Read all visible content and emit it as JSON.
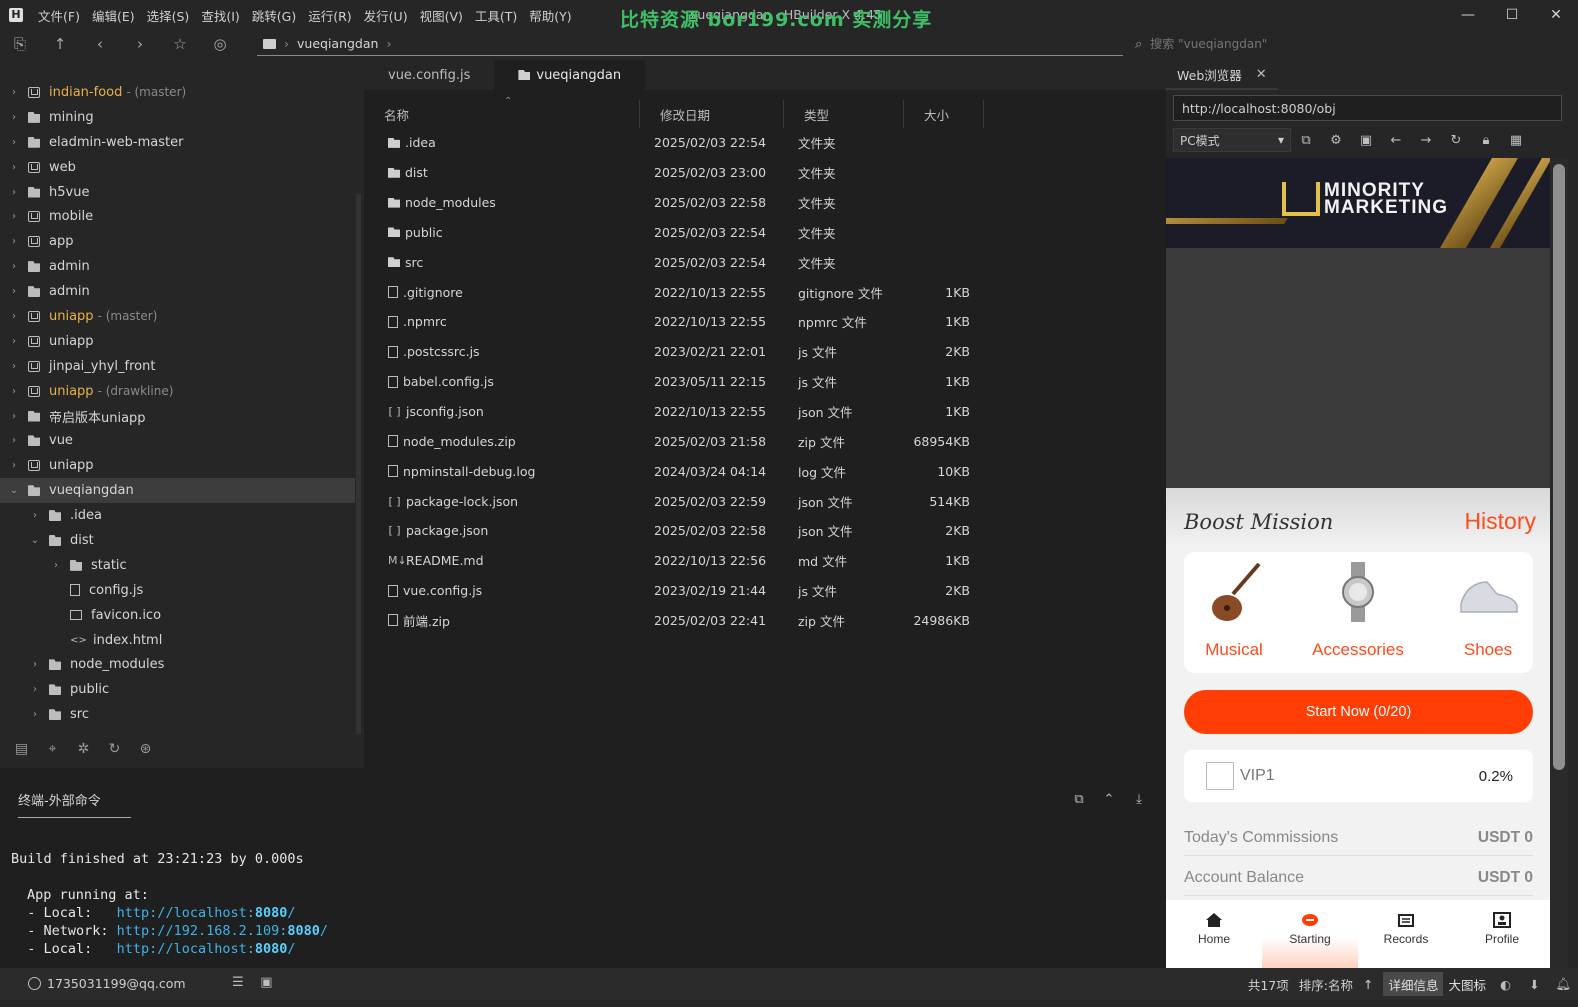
{
  "window": {
    "title": "vueqiangdan - HBuilder X 4.45",
    "watermark": "比特资源 bor199.com 实测分享",
    "menu": [
      "文件(F)",
      "编辑(E)",
      "选择(S)",
      "查找(I)",
      "跳转(G)",
      "运行(R)",
      "发行(U)",
      "视图(V)",
      "工具(T)",
      "帮助(Y)"
    ],
    "min_label": "—",
    "max_label": "☐",
    "close_label": "✕"
  },
  "toolbar": {
    "breadcrumb": "vueqiangdan",
    "search_placeholder": "搜索 \"vueqiangdan\""
  },
  "tree": {
    "items": [
      {
        "name": "indian-food",
        "branch": "- (master)",
        "icon": "u",
        "level": 0,
        "chev": "›",
        "yellow": true
      },
      {
        "name": "mining",
        "icon": "folder",
        "level": 0,
        "chev": "›"
      },
      {
        "name": "eladmin-web-master",
        "icon": "folder",
        "level": 0,
        "chev": "›"
      },
      {
        "name": "web",
        "icon": "u",
        "level": 0,
        "chev": "›"
      },
      {
        "name": "h5vue",
        "icon": "folder",
        "level": 0,
        "chev": "›"
      },
      {
        "name": "mobile",
        "icon": "u",
        "level": 0,
        "chev": "›"
      },
      {
        "name": "app",
        "icon": "u",
        "level": 0,
        "chev": "›"
      },
      {
        "name": "admin",
        "icon": "folder",
        "level": 0,
        "chev": "›"
      },
      {
        "name": "admin",
        "icon": "folder",
        "level": 0,
        "chev": "›"
      },
      {
        "name": "uniapp",
        "branch": "- (master)",
        "icon": "u",
        "level": 0,
        "chev": "›",
        "yellow": true
      },
      {
        "name": "uniapp",
        "icon": "u",
        "level": 0,
        "chev": "›"
      },
      {
        "name": "jinpai_yhyl_front",
        "icon": "u",
        "level": 0,
        "chev": "›"
      },
      {
        "name": "uniapp",
        "branch": "- (drawkline)",
        "icon": "u",
        "level": 0,
        "chev": "›",
        "yellow": true
      },
      {
        "name": "帝启版本uniapp",
        "icon": "folder",
        "level": 0,
        "chev": "›"
      },
      {
        "name": "vue",
        "icon": "folder",
        "level": 0,
        "chev": "›"
      },
      {
        "name": "uniapp",
        "icon": "u",
        "level": 0,
        "chev": "›"
      },
      {
        "name": "vueqiangdan",
        "icon": "folder",
        "level": 0,
        "chev": "⌄",
        "selected": true
      },
      {
        "name": ".idea",
        "icon": "folder",
        "level": 1,
        "chev": "›"
      },
      {
        "name": "dist",
        "icon": "folder",
        "level": 1,
        "chev": "⌄"
      },
      {
        "name": "static",
        "icon": "folder",
        "level": 2,
        "chev": "›"
      },
      {
        "name": "config.js",
        "icon": "file",
        "level": 2,
        "chev": ""
      },
      {
        "name": "favicon.ico",
        "icon": "img",
        "level": 2,
        "chev": ""
      },
      {
        "name": "index.html",
        "icon": "code",
        "level": 2,
        "chev": ""
      },
      {
        "name": "node_modules",
        "icon": "folder",
        "level": 1,
        "chev": "›"
      },
      {
        "name": "public",
        "icon": "folder",
        "level": 1,
        "chev": "›"
      },
      {
        "name": "src",
        "icon": "folder",
        "level": 1,
        "chev": "›"
      }
    ]
  },
  "editor": {
    "tabs": [
      {
        "label": "vue.config.js",
        "active": false
      },
      {
        "label": "vueqiangdan",
        "active": true
      }
    ],
    "columns": {
      "name": "名称",
      "date": "修改日期",
      "type": "类型",
      "size": "大小"
    },
    "files": [
      {
        "name": ".idea",
        "date": "2025/02/03 22:54",
        "type": "文件夹",
        "size": "",
        "icon": "folder"
      },
      {
        "name": "dist",
        "date": "2025/02/03 23:00",
        "type": "文件夹",
        "size": "",
        "icon": "folder"
      },
      {
        "name": "node_modules",
        "date": "2025/02/03 22:58",
        "type": "文件夹",
        "size": "",
        "icon": "folder"
      },
      {
        "name": "public",
        "date": "2025/02/03 22:54",
        "type": "文件夹",
        "size": "",
        "icon": "folder"
      },
      {
        "name": "src",
        "date": "2025/02/03 22:54",
        "type": "文件夹",
        "size": "",
        "icon": "folder"
      },
      {
        "name": ".gitignore",
        "date": "2022/10/13 22:55",
        "type": "gitignore 文件",
        "size": "1KB",
        "icon": "file"
      },
      {
        "name": ".npmrc",
        "date": "2022/10/13 22:55",
        "type": "npmrc 文件",
        "size": "1KB",
        "icon": "file"
      },
      {
        "name": ".postcssrc.js",
        "date": "2023/02/21 22:01",
        "type": "js 文件",
        "size": "2KB",
        "icon": "file"
      },
      {
        "name": "babel.config.js",
        "date": "2023/05/11 22:15",
        "type": "js 文件",
        "size": "1KB",
        "icon": "file"
      },
      {
        "name": "jsconfig.json",
        "date": "2022/10/13 22:55",
        "type": "json 文件",
        "size": "1KB",
        "icon": "json"
      },
      {
        "name": "node_modules.zip",
        "date": "2025/02/03 21:58",
        "type": "zip 文件",
        "size": "68954KB",
        "icon": "file"
      },
      {
        "name": "npminstall-debug.log",
        "date": "2024/03/24 04:14",
        "type": "log 文件",
        "size": "10KB",
        "icon": "file"
      },
      {
        "name": "package-lock.json",
        "date": "2025/02/03 22:59",
        "type": "json 文件",
        "size": "514KB",
        "icon": "json"
      },
      {
        "name": "package.json",
        "date": "2025/02/03 22:58",
        "type": "json 文件",
        "size": "2KB",
        "icon": "json"
      },
      {
        "name": "README.md",
        "date": "2022/10/13 22:56",
        "type": "md 文件",
        "size": "1KB",
        "icon": "md"
      },
      {
        "name": "vue.config.js",
        "date": "2023/02/19 21:44",
        "type": "js 文件",
        "size": "2KB",
        "icon": "file"
      },
      {
        "name": "前端.zip",
        "date": "2025/02/03 22:41",
        "type": "zip 文件",
        "size": "24986KB",
        "icon": "file"
      }
    ]
  },
  "browser": {
    "tab_label": "Web浏览器",
    "url": "http://localhost:8080/obj",
    "mode": "PC模式"
  },
  "phone": {
    "logo_line1": "MINORITY",
    "logo_line2": "MARKETING",
    "mission_title": "Boost Mission",
    "history": "History",
    "categories": [
      "Musical",
      "Accessories",
      "Shoes"
    ],
    "start_button": "Start Now  (0/20)",
    "vip_name": "VIP1",
    "vip_rate": "0.2%",
    "stats": [
      {
        "label": "Today's Commissions",
        "value": "USDT 0"
      },
      {
        "label": "Account Balance",
        "value": "USDT 0"
      }
    ],
    "nav": [
      {
        "label": "Home",
        "active": false
      },
      {
        "label": "Starting",
        "active": true
      },
      {
        "label": "Records",
        "active": false
      },
      {
        "label": "Profile",
        "active": false
      }
    ],
    "accent": "#ff3d05"
  },
  "terminal": {
    "tab_label": "终端-外部命令",
    "build_line": "Build finished at 23:21:23 by 0.000s",
    "running_line": "App running at:",
    "lines": [
      {
        "label": "  - Local:   ",
        "url": "http://localhost:",
        "port": "8080",
        "tail": "/"
      },
      {
        "label": "  - Network: ",
        "url": "http://192.168.2.109:",
        "port": "8080",
        "tail": "/"
      },
      {
        "label": "  - Local:   ",
        "url": "http://localhost:",
        "port": "8080",
        "tail": "/"
      }
    ]
  },
  "status": {
    "user": "1735031199@qq.com",
    "count": "共17项",
    "sort": "排序:名称",
    "sort_arrow": "↑",
    "detail_btn": "详细信息",
    "big_icon_btn": "大图标"
  }
}
